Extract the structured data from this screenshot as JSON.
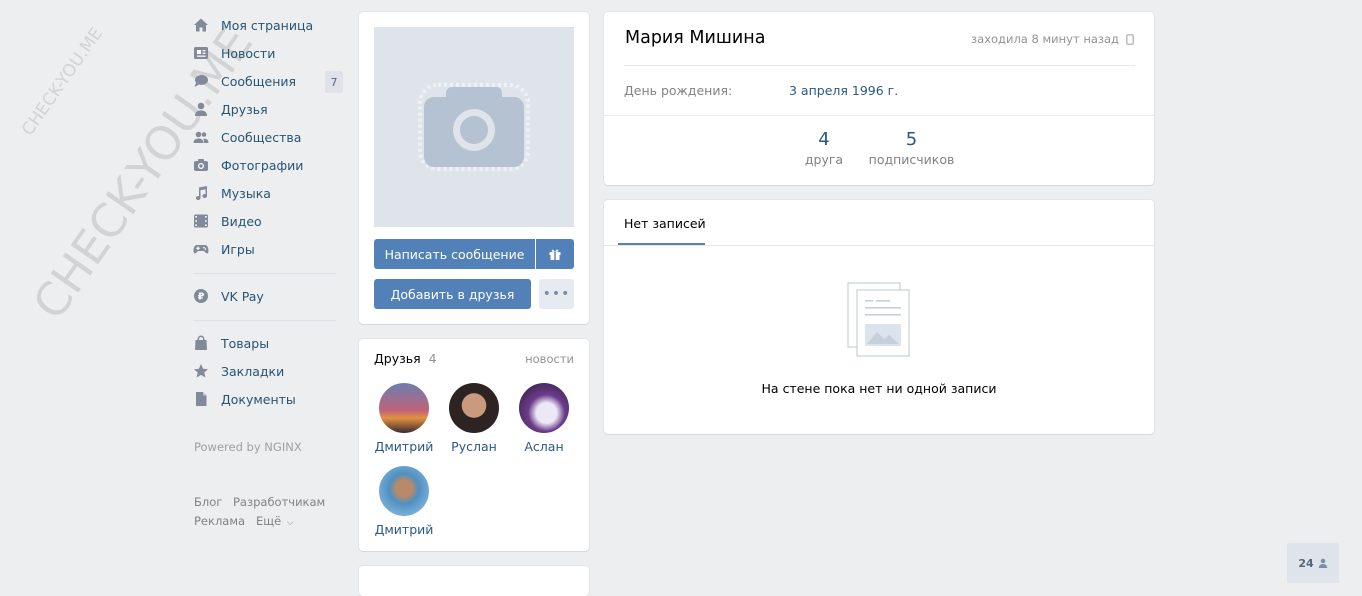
{
  "sidebar": {
    "items": [
      {
        "label": "Моя страница",
        "icon": "home-icon"
      },
      {
        "label": "Новости",
        "icon": "news-icon"
      },
      {
        "label": "Сообщения",
        "icon": "messages-icon",
        "badge": "7"
      },
      {
        "label": "Друзья",
        "icon": "friends-icon"
      },
      {
        "label": "Сообщества",
        "icon": "groups-icon"
      },
      {
        "label": "Фотографии",
        "icon": "camera-icon"
      },
      {
        "label": "Музыка",
        "icon": "music-icon"
      },
      {
        "label": "Видео",
        "icon": "video-icon"
      },
      {
        "label": "Игры",
        "icon": "games-icon"
      }
    ],
    "vkpay": {
      "label": "VK Pay",
      "icon": "vkpay-icon"
    },
    "extra": [
      {
        "label": "Товары",
        "icon": "shopping-bag-icon"
      },
      {
        "label": "Закладки",
        "icon": "star-icon"
      },
      {
        "label": "Документы",
        "icon": "document-icon"
      }
    ],
    "powered": "Powered by NGINX",
    "footer": {
      "blog": "Блог",
      "dev": "Разработчикам",
      "ads": "Реклама",
      "more": "Ещё"
    }
  },
  "profile_photo": {
    "message_button": "Написать сообщение",
    "add_friend_button": "Добавить в друзья"
  },
  "friends_block": {
    "title": "Друзья",
    "count": "4",
    "updates_link": "новости",
    "friends": [
      {
        "name": "Дмитрий"
      },
      {
        "name": "Руслан"
      },
      {
        "name": "Аслан"
      },
      {
        "name": "Дмитрий"
      }
    ]
  },
  "profile": {
    "name": "Мария Мишина",
    "last_seen": "заходила 8 минут назад",
    "birthday_label": "День рождения:",
    "birthday_value": "3 апреля 1996 г.",
    "counters": [
      {
        "value": "4",
        "label": "друга"
      },
      {
        "value": "5",
        "label": "подписчиков"
      }
    ]
  },
  "wall": {
    "tab": "Нет записей",
    "empty_text": "На стене пока нет ни одной записи"
  },
  "online_widget": {
    "count": "24"
  },
  "watermark": {
    "text1": "CHECK-YOU.ME",
    "text2": "CHECK-YOU.ME"
  },
  "colors": {
    "accent": "#5181b8",
    "link": "#2a5885",
    "background": "#edeef0"
  }
}
